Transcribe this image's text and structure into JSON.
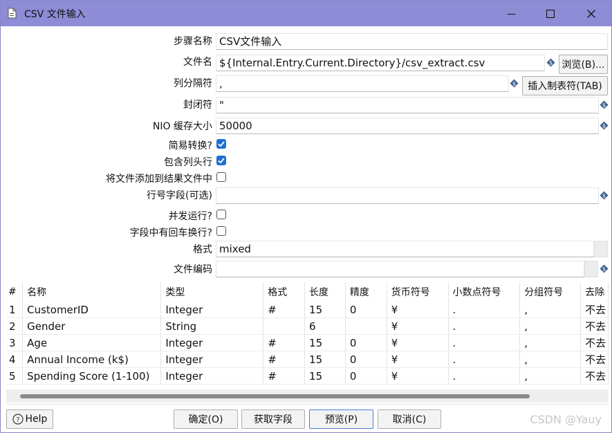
{
  "window": {
    "title": "CSV 文件输入",
    "colors": {
      "titlebar": "#8e8cd6",
      "accent": "#1f6fd1"
    }
  },
  "form": {
    "step_name_label": "步骤名称",
    "step_name_value": "CSV文件输入",
    "filename_label": "文件名",
    "filename_value": "${Internal.Entry.Current.Directory}/csv_extract.csv",
    "browse_button": "浏览(B)...",
    "delimiter_label": "列分隔符",
    "delimiter_value": ",",
    "insert_tab_button": "插入制表符(TAB)",
    "enclosure_label": "封闭符",
    "enclosure_value": "\"",
    "nio_label": "NIO 缓存大小",
    "nio_value": "50000",
    "lazy_label": "简易转换?",
    "lazy_checked": true,
    "header_label": "包含列头行",
    "header_checked": true,
    "add_result_label": "将文件添加到结果文件中",
    "add_result_checked": false,
    "rownum_label": "行号字段(可选)",
    "rownum_value": "",
    "parallel_label": "并发运行?",
    "parallel_checked": false,
    "newline_label": "字段中有回车换行?",
    "newline_checked": false,
    "format_label": "格式",
    "format_value": "mixed",
    "encoding_label": "文件编码",
    "encoding_value": ""
  },
  "table": {
    "headers": [
      "#",
      "名称",
      "类型",
      "格式",
      "长度",
      "精度",
      "货币符号",
      "小数点符号",
      "分组符号",
      "去除"
    ],
    "rows": [
      [
        "1",
        "CustomerID",
        "Integer",
        "#",
        "15",
        "0",
        "¥",
        ".",
        ",",
        "不去"
      ],
      [
        "2",
        "Gender",
        "String",
        "",
        "6",
        "",
        "¥",
        ".",
        ",",
        "不去"
      ],
      [
        "3",
        "Age",
        "Integer",
        "#",
        "15",
        "0",
        "¥",
        ".",
        ",",
        "不去"
      ],
      [
        "4",
        "Annual Income (k$)",
        "Integer",
        "#",
        "15",
        "0",
        "¥",
        ".",
        ",",
        "不去"
      ],
      [
        "5",
        "Spending Score (1-100)",
        "Integer",
        "#",
        "15",
        "0",
        "¥",
        ".",
        ",",
        "不去"
      ]
    ]
  },
  "footer": {
    "help": "Help",
    "ok": "确定(O)",
    "get_fields": "获取字段",
    "preview": "预览(P)",
    "cancel": "取消(C)",
    "watermark": "CSDN @Yauy"
  }
}
